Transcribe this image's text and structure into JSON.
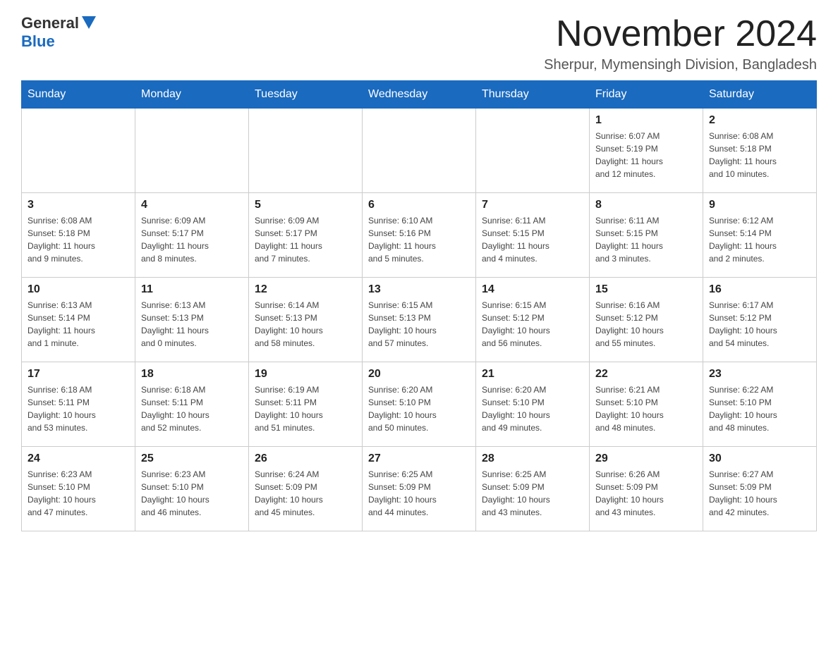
{
  "logo": {
    "general": "General",
    "blue": "Blue"
  },
  "title": "November 2024",
  "subtitle": "Sherpur, Mymensingh Division, Bangladesh",
  "weekdays": [
    "Sunday",
    "Monday",
    "Tuesday",
    "Wednesday",
    "Thursday",
    "Friday",
    "Saturday"
  ],
  "weeks": [
    [
      {
        "day": "",
        "info": ""
      },
      {
        "day": "",
        "info": ""
      },
      {
        "day": "",
        "info": ""
      },
      {
        "day": "",
        "info": ""
      },
      {
        "day": "",
        "info": ""
      },
      {
        "day": "1",
        "info": "Sunrise: 6:07 AM\nSunset: 5:19 PM\nDaylight: 11 hours\nand 12 minutes."
      },
      {
        "day": "2",
        "info": "Sunrise: 6:08 AM\nSunset: 5:18 PM\nDaylight: 11 hours\nand 10 minutes."
      }
    ],
    [
      {
        "day": "3",
        "info": "Sunrise: 6:08 AM\nSunset: 5:18 PM\nDaylight: 11 hours\nand 9 minutes."
      },
      {
        "day": "4",
        "info": "Sunrise: 6:09 AM\nSunset: 5:17 PM\nDaylight: 11 hours\nand 8 minutes."
      },
      {
        "day": "5",
        "info": "Sunrise: 6:09 AM\nSunset: 5:17 PM\nDaylight: 11 hours\nand 7 minutes."
      },
      {
        "day": "6",
        "info": "Sunrise: 6:10 AM\nSunset: 5:16 PM\nDaylight: 11 hours\nand 5 minutes."
      },
      {
        "day": "7",
        "info": "Sunrise: 6:11 AM\nSunset: 5:15 PM\nDaylight: 11 hours\nand 4 minutes."
      },
      {
        "day": "8",
        "info": "Sunrise: 6:11 AM\nSunset: 5:15 PM\nDaylight: 11 hours\nand 3 minutes."
      },
      {
        "day": "9",
        "info": "Sunrise: 6:12 AM\nSunset: 5:14 PM\nDaylight: 11 hours\nand 2 minutes."
      }
    ],
    [
      {
        "day": "10",
        "info": "Sunrise: 6:13 AM\nSunset: 5:14 PM\nDaylight: 11 hours\nand 1 minute."
      },
      {
        "day": "11",
        "info": "Sunrise: 6:13 AM\nSunset: 5:13 PM\nDaylight: 11 hours\nand 0 minutes."
      },
      {
        "day": "12",
        "info": "Sunrise: 6:14 AM\nSunset: 5:13 PM\nDaylight: 10 hours\nand 58 minutes."
      },
      {
        "day": "13",
        "info": "Sunrise: 6:15 AM\nSunset: 5:13 PM\nDaylight: 10 hours\nand 57 minutes."
      },
      {
        "day": "14",
        "info": "Sunrise: 6:15 AM\nSunset: 5:12 PM\nDaylight: 10 hours\nand 56 minutes."
      },
      {
        "day": "15",
        "info": "Sunrise: 6:16 AM\nSunset: 5:12 PM\nDaylight: 10 hours\nand 55 minutes."
      },
      {
        "day": "16",
        "info": "Sunrise: 6:17 AM\nSunset: 5:12 PM\nDaylight: 10 hours\nand 54 minutes."
      }
    ],
    [
      {
        "day": "17",
        "info": "Sunrise: 6:18 AM\nSunset: 5:11 PM\nDaylight: 10 hours\nand 53 minutes."
      },
      {
        "day": "18",
        "info": "Sunrise: 6:18 AM\nSunset: 5:11 PM\nDaylight: 10 hours\nand 52 minutes."
      },
      {
        "day": "19",
        "info": "Sunrise: 6:19 AM\nSunset: 5:11 PM\nDaylight: 10 hours\nand 51 minutes."
      },
      {
        "day": "20",
        "info": "Sunrise: 6:20 AM\nSunset: 5:10 PM\nDaylight: 10 hours\nand 50 minutes."
      },
      {
        "day": "21",
        "info": "Sunrise: 6:20 AM\nSunset: 5:10 PM\nDaylight: 10 hours\nand 49 minutes."
      },
      {
        "day": "22",
        "info": "Sunrise: 6:21 AM\nSunset: 5:10 PM\nDaylight: 10 hours\nand 48 minutes."
      },
      {
        "day": "23",
        "info": "Sunrise: 6:22 AM\nSunset: 5:10 PM\nDaylight: 10 hours\nand 48 minutes."
      }
    ],
    [
      {
        "day": "24",
        "info": "Sunrise: 6:23 AM\nSunset: 5:10 PM\nDaylight: 10 hours\nand 47 minutes."
      },
      {
        "day": "25",
        "info": "Sunrise: 6:23 AM\nSunset: 5:10 PM\nDaylight: 10 hours\nand 46 minutes."
      },
      {
        "day": "26",
        "info": "Sunrise: 6:24 AM\nSunset: 5:09 PM\nDaylight: 10 hours\nand 45 minutes."
      },
      {
        "day": "27",
        "info": "Sunrise: 6:25 AM\nSunset: 5:09 PM\nDaylight: 10 hours\nand 44 minutes."
      },
      {
        "day": "28",
        "info": "Sunrise: 6:25 AM\nSunset: 5:09 PM\nDaylight: 10 hours\nand 43 minutes."
      },
      {
        "day": "29",
        "info": "Sunrise: 6:26 AM\nSunset: 5:09 PM\nDaylight: 10 hours\nand 43 minutes."
      },
      {
        "day": "30",
        "info": "Sunrise: 6:27 AM\nSunset: 5:09 PM\nDaylight: 10 hours\nand 42 minutes."
      }
    ]
  ]
}
